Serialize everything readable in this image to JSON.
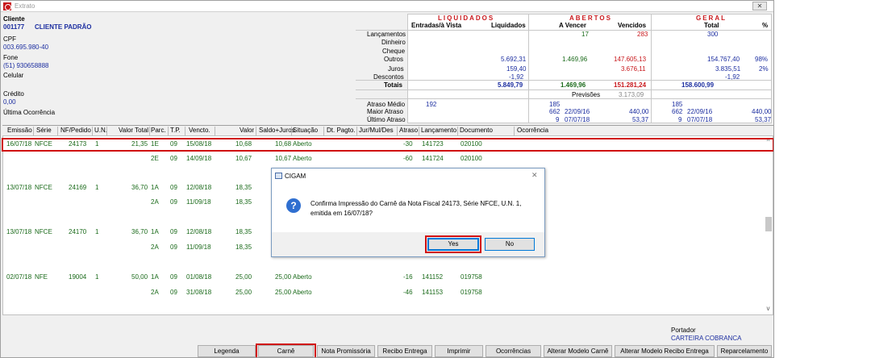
{
  "window": {
    "title": "Extrato",
    "close": "✕"
  },
  "cliente": {
    "label": "Cliente",
    "code": "001177",
    "name": "CLIENTE PADRÃO",
    "cpf_label": "CPF",
    "cpf": "003.695.980-40",
    "fone_label": "Fone",
    "fone": "(51) 930658888",
    "celular_label": "Celular",
    "credito_label": "Crédito",
    "credito": "0,00",
    "ultima_label": "Última Ocorrência"
  },
  "summary": {
    "sections": {
      "liquidados": "LIQUIDADOS",
      "abertos": "ABERTOS",
      "geral": "GERAL"
    },
    "subheads": {
      "entradas": "Entradas/à Vista",
      "liquidados": "Liquidados",
      "a_vencer": "A Vencer",
      "vencidos": "Vencidos",
      "total": "Total",
      "pct": "%"
    },
    "row_labels": {
      "lancamentos": "Lançamentos",
      "dinheiro": "Dinheiro",
      "cheque": "Cheque",
      "outros": "Outros",
      "juros": "Juros",
      "descontos": "Descontos",
      "totais": "Totais"
    },
    "lancamentos": {
      "a_vencer": "17",
      "vencidos": "283",
      "total": "300"
    },
    "outros": {
      "liquidados": "5.692,31",
      "a_vencer": "1.469,96",
      "vencidos": "147.605,13",
      "total": "154.767,40",
      "pct": "98%"
    },
    "juros": {
      "liquidados": "159,40",
      "vencidos": "3.676,11",
      "total": "3.835,51",
      "pct": "2%"
    },
    "descontos": {
      "liquidados": "-1,92",
      "total": "-1,92"
    },
    "totais": {
      "liquidados": "5.849,79",
      "a_vencer": "1.469,96",
      "vencidos": "151.281,24",
      "total": "158.600,99"
    },
    "previsoes_label": "Previsões",
    "previsoes": "3.173,09",
    "atraso_medio_label": "Atraso Médio",
    "maior_atraso_label": "Maior Atraso",
    "ultimo_atraso_label": "Último Atraso",
    "atraso_medio": {
      "liq": "192",
      "ab": "185",
      "ger": "185"
    },
    "maior_atraso": {
      "ab_dias": "662",
      "ab_data": "22/09/16",
      "ab_valor": "440,00",
      "ger_dias": "662",
      "ger_data": "22/09/16",
      "ger_valor": "440,00"
    },
    "ultimo_atraso": {
      "ab_dias": "9",
      "ab_data": "07/07/18",
      "ab_valor": "53,37",
      "ger_dias": "9",
      "ger_data": "07/07/18",
      "ger_valor": "53,37"
    }
  },
  "grid": {
    "columns": [
      "Emissão",
      "Série",
      "NF/Pedido",
      "U.N.",
      "Valor Total",
      "Parc.",
      "T.P.",
      "Vencto.",
      "Valor",
      "Saldo+Juros",
      "Situação",
      "Dt. Pagto.",
      "Jur/Mul/Des",
      "Atraso",
      "Lançamento",
      "Documento",
      "Ocorrência"
    ],
    "rows": [
      {
        "emissao": "16/07/18",
        "serie": "NFCE",
        "nf": "24173",
        "un": "1",
        "valor_total": "21,35",
        "parc": "1E",
        "tp": "09",
        "vencto": "15/08/18",
        "valor": "10,68",
        "saldo": "10,68",
        "situacao": "Aberto",
        "atraso": "-30",
        "lanc": "141723",
        "doc": "020100"
      },
      {
        "emissao": "",
        "serie": "",
        "nf": "",
        "un": "",
        "valor_total": "",
        "parc": "2E",
        "tp": "09",
        "vencto": "14/09/18",
        "valor": "10,67",
        "saldo": "10,67",
        "situacao": "Aberto",
        "atraso": "-60",
        "lanc": "141724",
        "doc": "020100"
      },
      {
        "emissao": "13/07/18",
        "serie": "NFCE",
        "nf": "24169",
        "un": "1",
        "valor_total": "36,70",
        "parc": "1A",
        "tp": "09",
        "vencto": "12/08/18",
        "valor": "18,35",
        "saldo": "",
        "situacao": "",
        "atraso": "",
        "lanc": "",
        "doc": ""
      },
      {
        "emissao": "",
        "serie": "",
        "nf": "",
        "un": "",
        "valor_total": "",
        "parc": "2A",
        "tp": "09",
        "vencto": "11/09/18",
        "valor": "18,35",
        "saldo": "",
        "situacao": "",
        "atraso": "",
        "lanc": "",
        "doc": ""
      },
      {
        "emissao": "13/07/18",
        "serie": "NFCE",
        "nf": "24170",
        "un": "1",
        "valor_total": "36,70",
        "parc": "1A",
        "tp": "09",
        "vencto": "12/08/18",
        "valor": "18,35",
        "saldo": "",
        "situacao": "",
        "atraso": "",
        "lanc": "",
        "doc": ""
      },
      {
        "emissao": "",
        "serie": "",
        "nf": "",
        "un": "",
        "valor_total": "",
        "parc": "2A",
        "tp": "09",
        "vencto": "11/09/18",
        "valor": "18,35",
        "saldo": "",
        "situacao": "",
        "atraso": "",
        "lanc": "",
        "doc": ""
      },
      {
        "emissao": "02/07/18",
        "serie": "NFE",
        "nf": "19004",
        "un": "1",
        "valor_total": "50,00",
        "parc": "1A",
        "tp": "09",
        "vencto": "01/08/18",
        "valor": "25,00",
        "saldo": "25,00",
        "situacao": "Aberto",
        "atraso": "-16",
        "lanc": "141152",
        "doc": "019758"
      },
      {
        "emissao": "",
        "serie": "",
        "nf": "",
        "un": "",
        "valor_total": "",
        "parc": "2A",
        "tp": "09",
        "vencto": "31/08/18",
        "valor": "25,00",
        "saldo": "25,00",
        "situacao": "Aberto",
        "atraso": "-46",
        "lanc": "141153",
        "doc": "019758"
      }
    ]
  },
  "dialog": {
    "title": "CIGAM",
    "message": "Confirma Impressão do Carnê da Nota Fiscal 24173, Série NFCE, U.N. 1, emitida em 16/07/18?",
    "yes": "Yes",
    "no": "No"
  },
  "portador": {
    "label": "Portador",
    "value": "CARTEIRA COBRANCA"
  },
  "toolbar": {
    "legenda": "Legenda",
    "carne": "Carnê",
    "nota_promissoria": "Nota Promissória",
    "recibo_entrega": "Recibo Entrega",
    "imprimir": "Imprimir",
    "ocorrencias": "Ocorrências",
    "alterar_modelo_carne": "Alterar Modelo Carnê",
    "alterar_modelo_recibo": "Alterar Modelo Recibo Entrega",
    "reparcelamento": "Reparcelamento"
  }
}
